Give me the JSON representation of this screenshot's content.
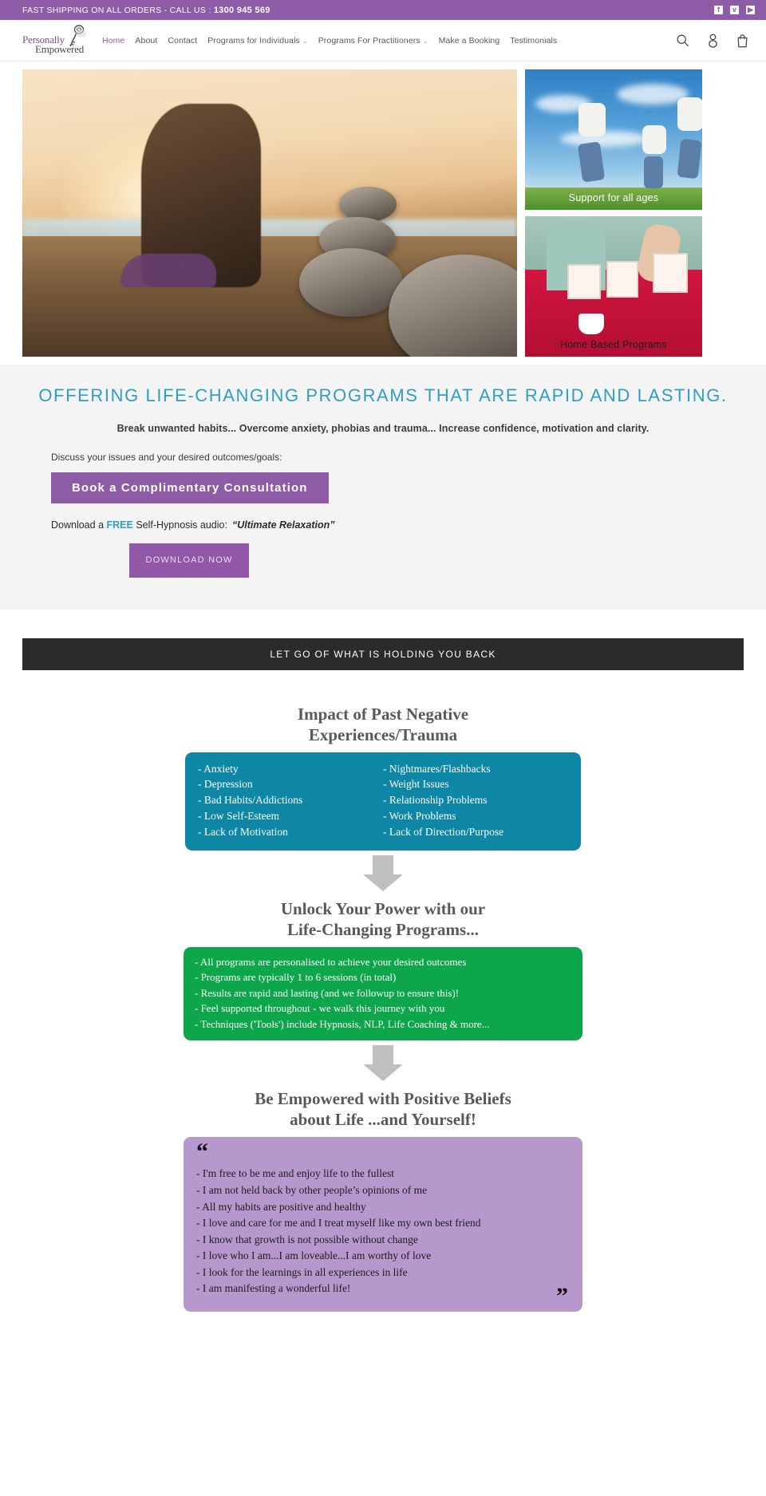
{
  "announcement": {
    "text": "FAST SHIPPING ON ALL ORDERS - CALL US : ",
    "phone": "1300 945 569",
    "social": [
      {
        "name": "facebook-icon",
        "glyph": "f"
      },
      {
        "name": "twitter-icon",
        "glyph": "ᴠ"
      },
      {
        "name": "youtube-icon",
        "glyph": "▶"
      }
    ]
  },
  "header": {
    "logo": {
      "line1": "Personally",
      "line2": "Empowered",
      "icon": "key-icon"
    },
    "nav": [
      {
        "label": "Home",
        "active": true,
        "caret": ""
      },
      {
        "label": "About",
        "active": false,
        "caret": ""
      },
      {
        "label": "Contact",
        "active": false,
        "caret": ""
      },
      {
        "label": "Programs for Individuals",
        "active": false,
        "caret": "⌄"
      },
      {
        "label": "Programs For Practitioners",
        "active": false,
        "caret": "⌄"
      },
      {
        "label": "Make a Booking",
        "active": false,
        "caret": ""
      },
      {
        "label": "Testimonials",
        "active": false,
        "caret": ""
      }
    ],
    "icons": [
      {
        "name": "search-icon"
      },
      {
        "name": "account-icon"
      },
      {
        "name": "cart-icon"
      }
    ]
  },
  "hero": {
    "main_image_alt": "woman meditating at sunset beside stacked stones on a beach",
    "tiles": [
      {
        "caption": "Support for all ages",
        "alt": "family jumping in the air in a green field"
      },
      {
        "caption": "Home Based Programs",
        "alt": "woman at a red table with workbooks and a coffee cup"
      }
    ]
  },
  "offering": {
    "heading": "OFFERING LIFE-CHANGING PROGRAMS THAT ARE RAPID AND LASTING.",
    "subheading": "Break unwanted habits... Overcome anxiety, phobias and trauma... Increase confidence, motivation and clarity.",
    "discuss": "Discuss your issues and your desired outcomes/goals:",
    "book_button": "Book a Complimentary Consultation",
    "download_prefix": "Download a ",
    "download_free": "FREE",
    "download_mid": " Self-Hypnosis audio:",
    "download_title": "“Ultimate Relaxation”",
    "download_button": "DOWNLOAD NOW",
    "accent_heading_color": "#2e9ec4",
    "accent_button_color": "#8E5BA6"
  },
  "banner": {
    "text": "LET GO OF WHAT IS HOLDING YOU BACK",
    "background": "#2b2b2b"
  },
  "flow": {
    "steps": [
      {
        "title_line1": "Impact of Past Negative",
        "title_line2": "Experiences/Trauma",
        "color": "#0d87a5",
        "column_left": [
          "-  Anxiety",
          "-  Depression",
          "-  Bad Habits/Addictions",
          "-  Low Self-Esteem",
          "-  Lack of Motivation"
        ],
        "column_right": [
          "-  Nightmares/Flashbacks",
          "-  Weight Issues",
          "-  Relationship Problems",
          "-  Work Problems",
          "-  Lack of Direction/Purpose"
        ]
      },
      {
        "title_line1": "Unlock Your Power with our",
        "title_line2": "Life-Changing Programs...",
        "color": "#0ea64a",
        "items": [
          "-  All programs are personalised to achieve your desired outcomes",
          "-  Programs are typically 1 to 6 sessions (in total)",
          "-  Results are rapid and lasting (and we followup to ensure this)!",
          "-  Feel supported throughout - we walk this journey with you",
          "-  Techniques ('Tools') include Hypnosis, NLP, Life Coaching & more..."
        ]
      },
      {
        "title_line1": "Be Empowered with Positive Beliefs",
        "title_line2": "about Life ...and Yourself!",
        "color": "#b698cd",
        "quote_open": "“",
        "quote_close": "”",
        "items": [
          "-  I'm free to be me and enjoy life to the fullest",
          "-  I am not held back by other people’s opinions of me",
          "-  All my habits are positive and healthy",
          "-  I love and care for me and I treat myself like my own best friend",
          "-  I know that growth is not possible without change",
          "-  I love who I am...I am loveable...I am worthy of love",
          "-  I look for the learnings in all experiences in life",
          "-  I am manifesting a wonderful life!"
        ]
      }
    ],
    "arrow_color": "#bfbfbf"
  }
}
